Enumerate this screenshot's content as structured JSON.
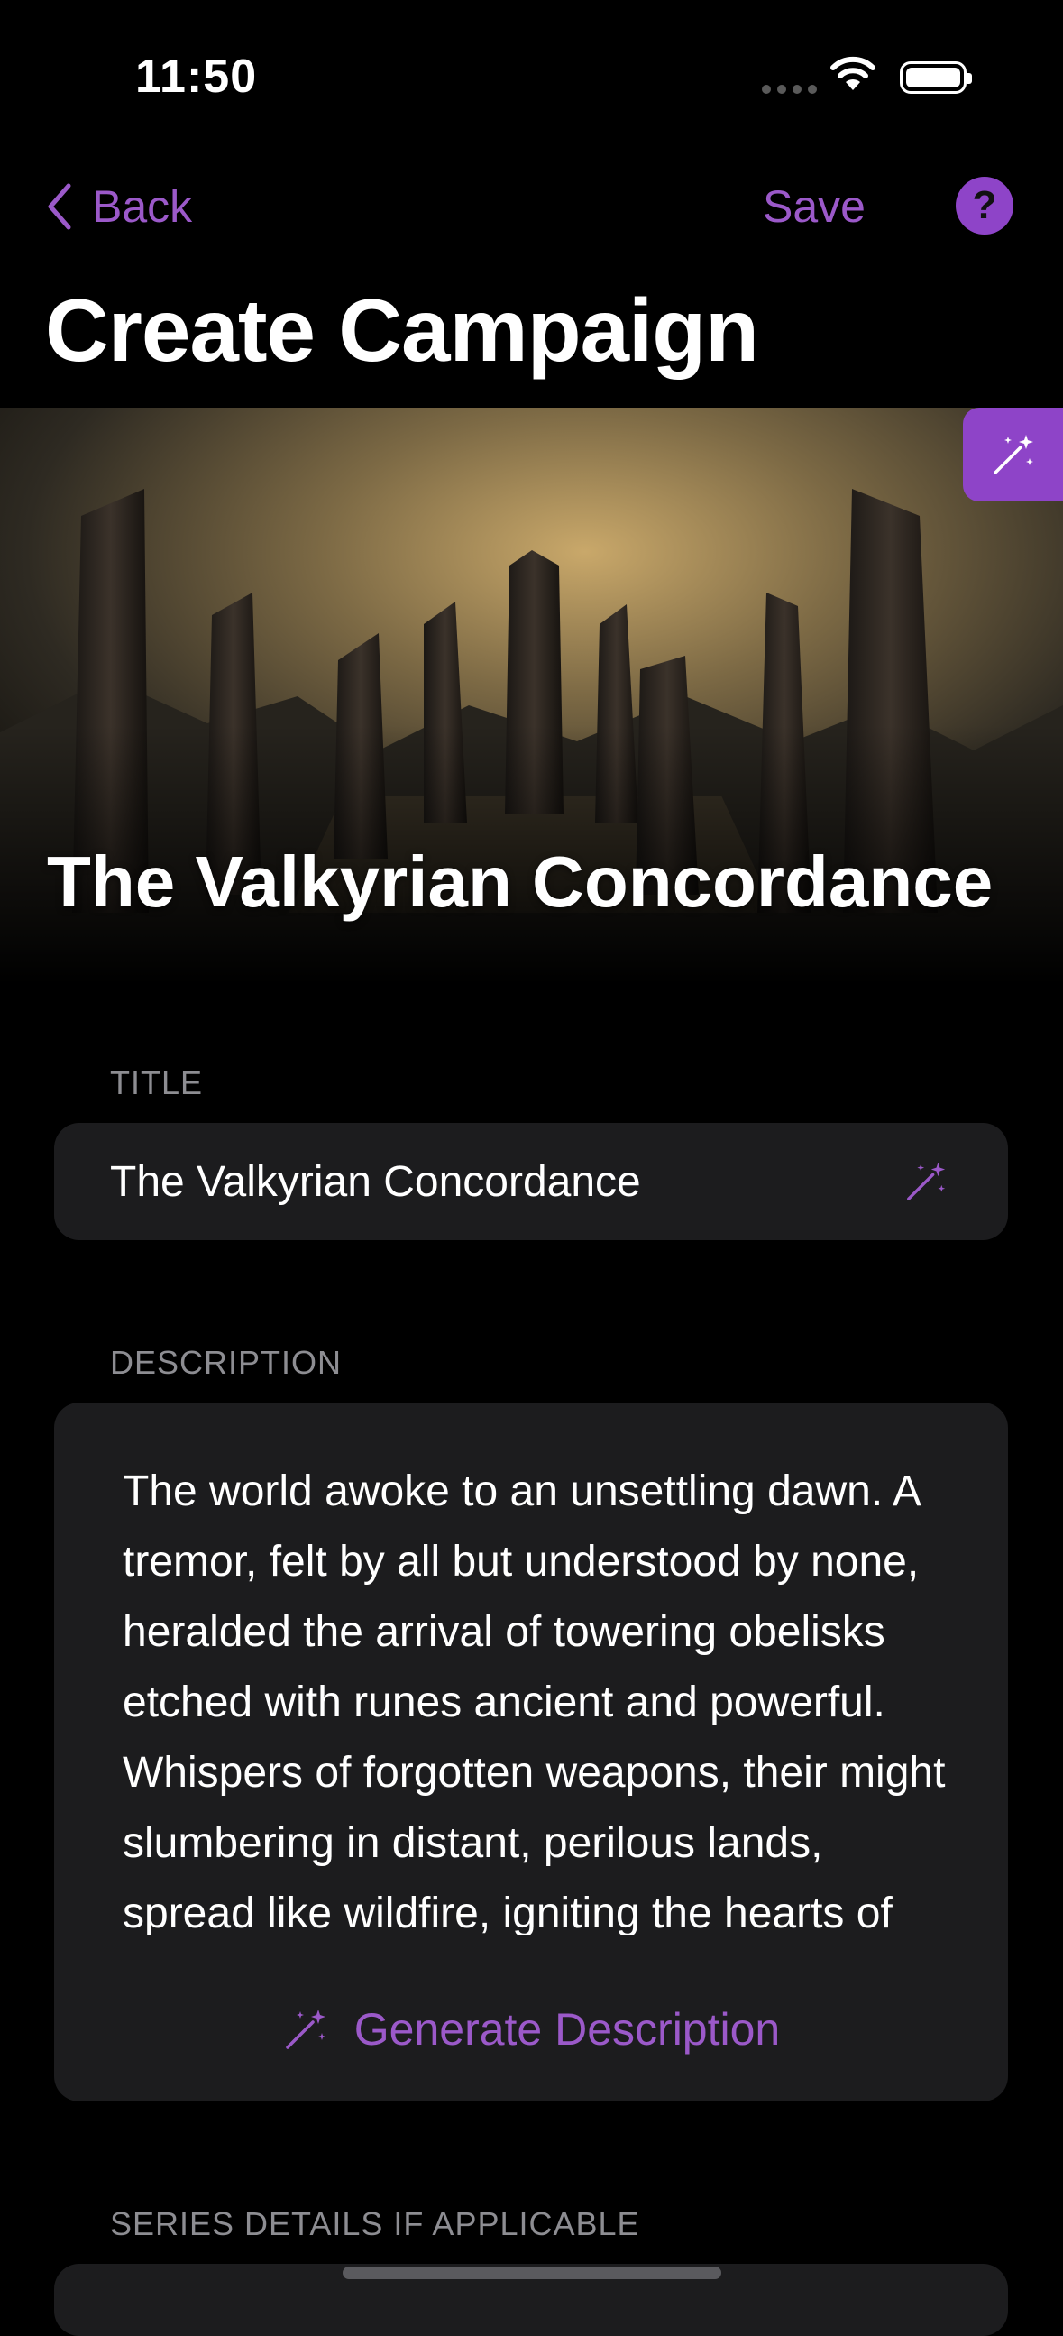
{
  "status": {
    "time": "11:50"
  },
  "nav": {
    "back_label": "Back",
    "save_label": "Save",
    "help_label": "?"
  },
  "page": {
    "title": "Create Campaign"
  },
  "hero": {
    "campaign_title": "The Valkyrian Concordance"
  },
  "form": {
    "title_label": "TITLE",
    "title_value": "The Valkyrian Concordance",
    "description_label": "DESCRIPTION",
    "description_text": "The world awoke to an unsettling dawn. A tremor, felt by all but understood by none, heralded the arrival of towering obelisks etched with runes ancient and powerful. Whispers of forgotten weapons, their might slumbering in distant, perilous lands, spread like wildfire, igniting the hearts of",
    "generate_label": "Generate Description",
    "series_label": "SERIES DETAILS IF APPLICABLE"
  },
  "colors": {
    "accent": "#9b59c9",
    "field_bg": "#1c1c1e",
    "label": "#8d8d92"
  },
  "icons": [
    "chevron-left-icon",
    "help-icon",
    "magic-wand-icon",
    "wifi-icon",
    "battery-icon"
  ]
}
